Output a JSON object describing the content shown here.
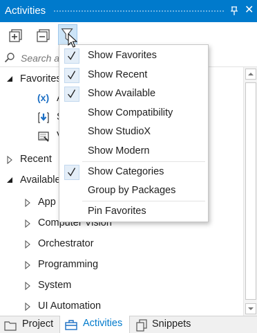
{
  "window": {
    "title": "Activities"
  },
  "toolbar": {
    "expand_tooltip": "",
    "collapse_tooltip": "",
    "filter_tooltip": ""
  },
  "search": {
    "placeholder": "Search a",
    "value": ""
  },
  "tree": {
    "favorites": {
      "label": "Favorites",
      "items": [
        "A",
        "S",
        "V"
      ]
    },
    "recent": {
      "label": "Recent"
    },
    "available": {
      "label": "Available",
      "children": [
        "App",
        "Computer Vision",
        "Orchestrator",
        "Programming",
        "System",
        "UI Automation"
      ]
    }
  },
  "menu": {
    "items": [
      {
        "label": "Show Favorites",
        "checked": true
      },
      {
        "label": "Show Recent",
        "checked": true
      },
      {
        "label": "Show Available",
        "checked": true
      },
      {
        "label": "Show Compatibility",
        "checked": false
      },
      {
        "label": "Show StudioX",
        "checked": false
      },
      {
        "label": "Show Modern",
        "checked": false
      },
      {
        "label": "Show Categories",
        "checked": true
      },
      {
        "label": "Group by Packages",
        "checked": false
      },
      {
        "label": "Pin Favorites",
        "checked": false
      }
    ]
  },
  "tabs": [
    {
      "label": "Project",
      "icon": "folder-icon",
      "active": false
    },
    {
      "label": "Activities",
      "icon": "toolbox-icon",
      "active": true
    },
    {
      "label": "Snippets",
      "icon": "snippets-icon",
      "active": false
    }
  ],
  "colors": {
    "accent": "#007acc",
    "menu_check_bg": "#e4eef8",
    "icon_blue": "#1c6fc4"
  }
}
